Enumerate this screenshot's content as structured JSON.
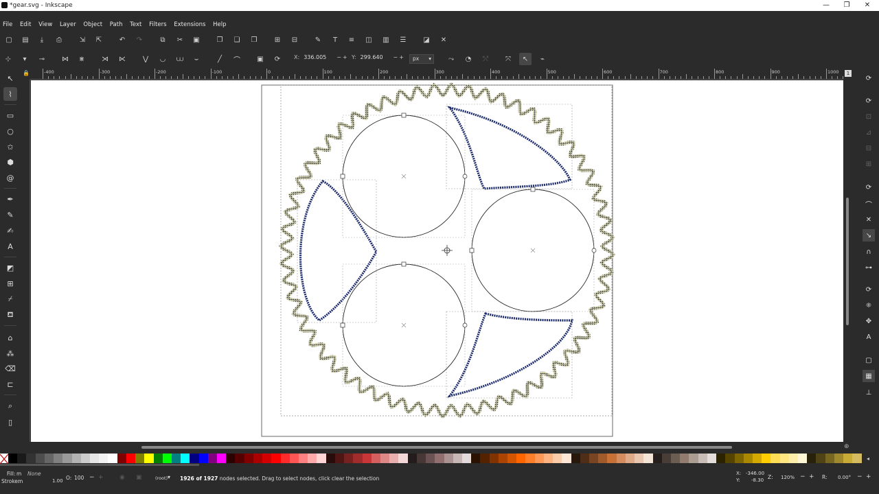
{
  "window": {
    "title": "*gear.svg - Inkscape",
    "minimize": "—",
    "maximize": "❐",
    "close": "✕"
  },
  "menu": [
    "File",
    "Edit",
    "View",
    "Layer",
    "Object",
    "Path",
    "Text",
    "Filters",
    "Extensions",
    "Help"
  ],
  "node_toolbar": {
    "x_label": "X:",
    "x_value": "336.005",
    "y_label": "Y:",
    "y_value": "299.640",
    "unit": "px"
  },
  "ruler_labels": [
    "-400",
    "-300",
    "-200",
    "-100",
    "0",
    "100",
    "200",
    "300",
    "400",
    "500",
    "600",
    "700",
    "800",
    "900",
    "1000"
  ],
  "palette_colors": [
    "#000000",
    "#1a1a1a",
    "#333333",
    "#4d4d4d",
    "#666666",
    "#808080",
    "#999999",
    "#b3b3b3",
    "#cccccc",
    "#e6e6e6",
    "#f2f2f2",
    "#ffffff",
    "#800000",
    "#ff0000",
    "#808000",
    "#ffff00",
    "#008000",
    "#00ff00",
    "#008080",
    "#00ffff",
    "#000080",
    "#0000ff",
    "#800080",
    "#ff00ff",
    "#2b0000",
    "#550000",
    "#800000",
    "#aa0000",
    "#d40000",
    "#ff0000",
    "#ff2a2a",
    "#ff5555",
    "#ff8080",
    "#ffaaaa",
    "#ffd5d5",
    "#280b0b",
    "#501616",
    "#782121",
    "#a02c2c",
    "#c83737",
    "#d35f5f",
    "#de8787",
    "#e9afaf",
    "#f4d7d7",
    "#241c1c",
    "#483737",
    "#6c5353",
    "#916f6f",
    "#ac9393",
    "#c8b7b7",
    "#e3dbdb",
    "#2b1100",
    "#552200",
    "#803300",
    "#aa4400",
    "#d45500",
    "#ff6600",
    "#ff7f2a",
    "#ff9955",
    "#ffb380",
    "#ffccaa",
    "#ffe6d5",
    "#28170b",
    "#502d16",
    "#784421",
    "#a05a2c",
    "#c87137",
    "#d38d5f",
    "#deaa87",
    "#e9c6af",
    "#f4e3d7",
    "#241f1c",
    "#483e37",
    "#6c5d53",
    "#917c6f",
    "#ac9d93",
    "#c8beb7",
    "#e3dedb",
    "#2b2200",
    "#554400",
    "#806600",
    "#aa8800",
    "#d4aa00",
    "#ffcc00",
    "#ffdd55",
    "#ffe680",
    "#ffeeaa",
    "#fff6d5",
    "#28220b",
    "#504416",
    "#786721",
    "#a0892c",
    "#c8ab37",
    "#d3bc5f"
  ],
  "status": {
    "fill_label": "Fill:",
    "fill_value": "m",
    "fill_none": "None",
    "stroke_label": "Stroke:",
    "stroke_value": "m",
    "stroke_width": "1.00",
    "opacity_label": "O:",
    "opacity_value": "100",
    "layer": "(root)",
    "message_bold": "1926 of 1927",
    "message_rest": " nodes selected. Drag to select nodes, click clear the selection",
    "cursor_x_label": "X:",
    "cursor_x": "-346.00",
    "cursor_y_label": "Y:",
    "cursor_y": "-8.30",
    "zoom_label": "Z:",
    "zoom": "120%",
    "rotate_label": "R:",
    "rotate": "0.00°"
  }
}
